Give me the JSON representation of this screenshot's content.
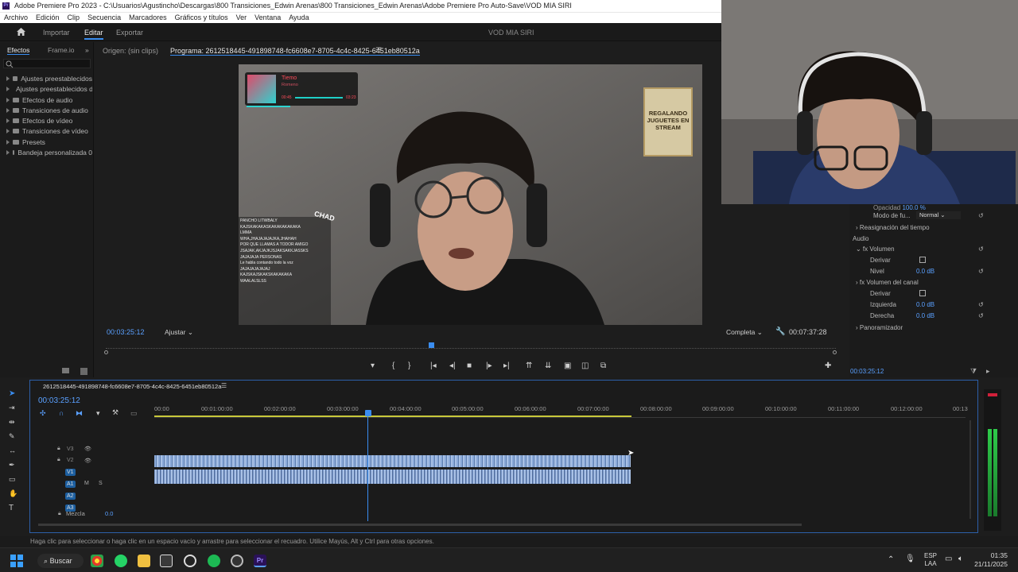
{
  "titlebar": {
    "icon_text": "Pr",
    "title": "Adobe Premiere Pro 2023 - C:\\Usuarios\\Agustincho\\Descargas\\800 Transiciones_Edwin Arenas\\800 Transiciones_Edwin Arenas\\Adobe Premiere Pro Auto-Save\\VOD MIA SIRI"
  },
  "menu": [
    "Archivo",
    "Edición",
    "Clip",
    "Secuencia",
    "Marcadores",
    "Gráficos y títulos",
    "Ver",
    "Ventana",
    "Ayuda"
  ],
  "workspace": {
    "tabs": [
      "Importar",
      "Editar",
      "Exportar"
    ],
    "active": "Editar",
    "project_name": "VOD MIA SIRI"
  },
  "effects_panel": {
    "tabs": [
      "Efectos",
      "Frame.io"
    ],
    "items": [
      "Ajustes preestablecidos",
      "Ajustes preestablecidos d",
      "Efectos de audio",
      "Transiciones de audio",
      "Efectos de vídeo",
      "Transiciones de vídeo",
      "Presets",
      "Bandeja personalizada 0"
    ]
  },
  "monitor": {
    "source_tab": "Origen: (sin clips)",
    "program_tab": "Programa: 2612518445-491898748-fc6608e7-8705-4c4c-8425-6451eb80512a",
    "timecode": "00:03:25:12",
    "fit": "Ajustar",
    "quality": "Completa",
    "duration": "00:07:37:28"
  },
  "overlay": {
    "now_playing_title": "Tiemo",
    "now_playing_sub": "Romeno",
    "t_start": "00:45",
    "t_end": "03:23",
    "chad_label": "CHAD",
    "poster_text": "REGALANDO JUGUETES EN STREAM",
    "chat": [
      "PANCHO LITWBALY",
      "KAJSKAKAKASKAKAKAKAKAKA",
      "LMMA",
      "WHA,JHAJAJAJAJKA,JHAHAH",
      "POR QUE LLAMAS A TODOR AMIGO",
      "JSAJAK,AKJAJKJSJAKSAKKJASSKS",
      "JAJAJAJA PERSONAS",
      "Le habla contando todo la voz",
      "JAJAJAJAJAJAJ",
      "KAJSKAJSKAKSKAKAKAKA",
      "WAALALSLSS"
    ]
  },
  "effect_controls": {
    "opacidad_label": "Opacidad",
    "modo_label": "Modo de fu...",
    "modo_value": "Normal",
    "reasign": "Reasignación del tiempo",
    "audio": "Audio",
    "volumen": "Volumen",
    "derivar": "Derivar",
    "nivel": "Nivel",
    "nivel_value": "0.0 dB",
    "vol_canal": "Volumen del canal",
    "izquierda": "Izquierda",
    "derecha": "Derecha",
    "izq_value": "0.0 dB",
    "der_value": "0.0 dB",
    "panoramizador": "Panoramizador",
    "timecode": "00:03:25:12"
  },
  "timeline": {
    "sequence_tab": "2612518445-491898748-fc6608e7-8705-4c4c-8425-6451eb80512a",
    "timecode": "00:03:25:12",
    "ruler": [
      "00:00",
      "00:01:00:00",
      "00:02:00:00",
      "00:03:00:00",
      "00:04:00:00",
      "00:05:00:00",
      "00:06:00:00",
      "00:07:00:00",
      "00:08:00:00",
      "00:09:00:00",
      "00:10:00:00",
      "00:11:00:00",
      "00:12:00:00",
      "00:13"
    ],
    "tracks": [
      "V3",
      "V2",
      "V1",
      "A1",
      "A2",
      "A3"
    ],
    "mix_label": "Mezcla",
    "mix_value": "0.0"
  },
  "status_text": "Haga clic para seleccionar o haga clic en un espacio vacío y arrastre para seleccionar el recuadro. Utilice Mayús, Alt y Ctrl para otras opciones.",
  "taskbar": {
    "search": "Buscar",
    "lang": "ESP",
    "region": "LAA",
    "time": "01:35",
    "date": "21/11/2025"
  },
  "colors": {
    "accent": "#2d8cff",
    "selected_track": "#1d5fa0",
    "audio_clip": "#8aa9d8"
  }
}
